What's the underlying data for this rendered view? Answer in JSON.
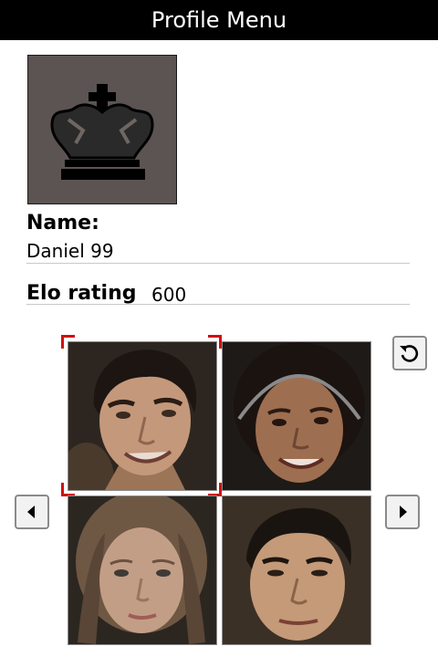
{
  "header": {
    "title": "Profile Menu"
  },
  "profile": {
    "avatar_icon": "chess-king-icon",
    "name_label": "Name:",
    "name_value": "Daniel 99",
    "elo_label": "Elo rating",
    "elo_value": "600"
  },
  "portrait_picker": {
    "selected_index": 0,
    "portraits": [
      {
        "name": "portrait-man-dark-hair"
      },
      {
        "name": "portrait-woman-headphones"
      },
      {
        "name": "portrait-girl-blonde"
      },
      {
        "name": "portrait-man-short-hair"
      }
    ],
    "icons": {
      "rotate": "rotate-icon",
      "prev": "arrow-left-icon",
      "next": "arrow-right-icon"
    }
  },
  "colors": {
    "titlebar_bg": "#000000",
    "selection_corner": "#d01010",
    "avatar_bg": "#5c5452"
  }
}
